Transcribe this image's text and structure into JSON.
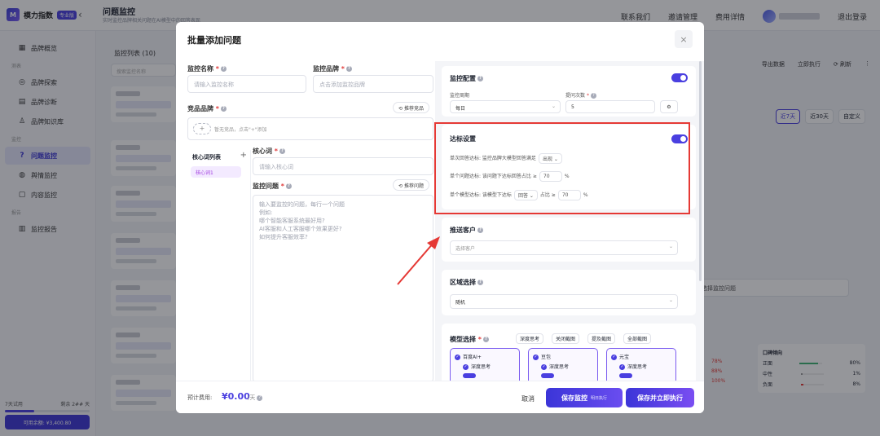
{
  "brand": {
    "name": "模力指数",
    "badge": "专业版",
    "logo_letter": "M"
  },
  "header": {
    "title": "问题监控",
    "subtitle": "实时监控品牌相关问题在AI模型中的回答表现",
    "nav": [
      "联系我们",
      "邀请管理",
      "费用详情"
    ],
    "logout": "退出登录"
  },
  "sidebar": {
    "items_top": [
      {
        "icon": "▦",
        "label": "品牌概览"
      }
    ],
    "group_measure": "测表",
    "items_measure": [
      {
        "icon": "◎",
        "label": "品牌探索"
      },
      {
        "icon": "▤",
        "label": "品牌诊断"
      },
      {
        "icon": "♙",
        "label": "品牌知识库"
      }
    ],
    "group_monitor": "监控",
    "items_monitor": [
      {
        "icon": "?",
        "label": "问题监控"
      },
      {
        "icon": "◍",
        "label": "舆情监控"
      },
      {
        "icon": "▢",
        "label": "内容监控"
      }
    ],
    "group_report": "报告",
    "items_report": [
      {
        "icon": "▥",
        "label": "监控报告"
      }
    ],
    "trial": {
      "label": "7天试用",
      "remain": "剩余 2## 天",
      "progress": 0.35,
      "button": "可用余额: ¥3,400.80"
    }
  },
  "background": {
    "list_title": "监控列表 (10)",
    "search_placeholder": "搜索监控名称",
    "buttons": [
      "导出数据",
      "立即执行",
      "刷新"
    ],
    "tabs": [
      "近7天",
      "近30天",
      "自定义"
    ],
    "select": "选择监控问题",
    "stats": {
      "title": "口碑倾向",
      "left_pcts": [
        "78%",
        "88%",
        "100%"
      ],
      "rows": [
        {
          "label": "正面",
          "pct": "80%"
        },
        {
          "label": "中性",
          "pct": "1%"
        },
        {
          "label": "负面",
          "pct": "8%"
        }
      ]
    }
  },
  "modal": {
    "title": "批量添加问题",
    "close": "×",
    "monitor_name": {
      "label": "监控名称",
      "placeholder": "请输入监控名称"
    },
    "monitor_brand": {
      "label": "监控品牌",
      "placeholder": "点击添加监控品牌"
    },
    "competitor": {
      "label": "竞品品牌",
      "recommend": "推荐竞品",
      "empty": "暂无竞品，点击\"+\"添加"
    },
    "keyword_list": {
      "title": "核心词列表",
      "add": "+",
      "item": "核心词1"
    },
    "keyword": {
      "label": "核心词",
      "placeholder": "请输入核心词"
    },
    "question": {
      "label": "监控问题",
      "recommend": "推荐问题",
      "placeholder_lines": [
        "输入要监控的问题，每行一个问题",
        "例如:",
        "哪个智能客服系统最好用?",
        "AI客服和人工客服哪个效果更好?",
        "如何提升客服效率?"
      ]
    },
    "config": {
      "title": "监控配置",
      "period_label": "监控周期",
      "period_value": "每日",
      "count_label": "提问次数",
      "count_value": "5"
    },
    "target": {
      "title": "达标设置",
      "row1_prefix": "单次回答达标: 监控品牌大模型回答满足",
      "row1_value": "出现",
      "row2_prefix": "单个问题达标: 该问题下达标回答占比 ≥",
      "row2_value": "70",
      "row3_prefix": "单个模型达标: 该模型下达标",
      "row3_select": "回答",
      "row3_mid": "占比 ≥",
      "row3_value": "70",
      "unit": "%"
    },
    "customer": {
      "title": "推送客户",
      "placeholder": "选择客户"
    },
    "region": {
      "title": "区域选择",
      "value": "随机"
    },
    "models": {
      "title": "模型选择",
      "options": [
        "深度思考",
        "关闭截图",
        "提及截图",
        "全部截图"
      ],
      "cards": [
        {
          "name": "百度AI+",
          "feature": "深度思考"
        },
        {
          "name": "豆包",
          "feature": "深度思考"
        },
        {
          "name": "元宝",
          "feature": "深度思考"
        }
      ]
    },
    "footer": {
      "cost_label": "预计费用:",
      "cost_value": "¥0.00",
      "cost_unit": "/天",
      "cancel": "取消",
      "save": "保存监控",
      "save_note": "明日执行",
      "save_run": "保存并立即执行"
    }
  },
  "colors": {
    "accent": "#4a3fe0",
    "highlight": "#e53935"
  }
}
